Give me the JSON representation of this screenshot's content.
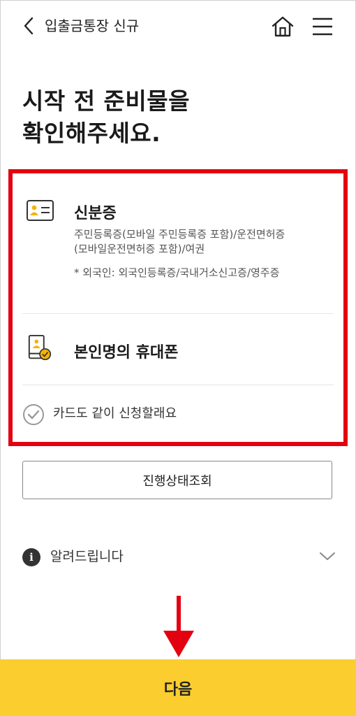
{
  "header": {
    "title": "입출금통장 신규",
    "back_icon": "chevron-left-icon",
    "home_icon": "home-icon",
    "menu_icon": "hamburger-menu-icon"
  },
  "headline": "시작 전 준비물을\n확인해주세요.",
  "checklist": {
    "items": [
      {
        "icon": "id-card-icon",
        "title": "신분증",
        "desc1": "주민등록증(모바일 주민등록증 포함)/운전면허증(모바일운전면허증 포함)/여권",
        "desc2": "* 외국인: 외국인등록증/국내거소신고증/영주증"
      },
      {
        "icon": "phone-verified-icon",
        "title": "본인명의 휴대폰"
      }
    ],
    "card_option": {
      "icon": "check-circle-icon",
      "label": "카드도 같이 신청할래요"
    }
  },
  "status_button": {
    "label": "진행상태조회"
  },
  "notice": {
    "icon": "info-icon",
    "glyph": "i",
    "label": "알려드립니다"
  },
  "next_button": {
    "label": "다음"
  },
  "colors": {
    "accent_yellow": "#fbcd2e",
    "highlight_red": "#e30010",
    "icon_gold": "#f5b400"
  }
}
